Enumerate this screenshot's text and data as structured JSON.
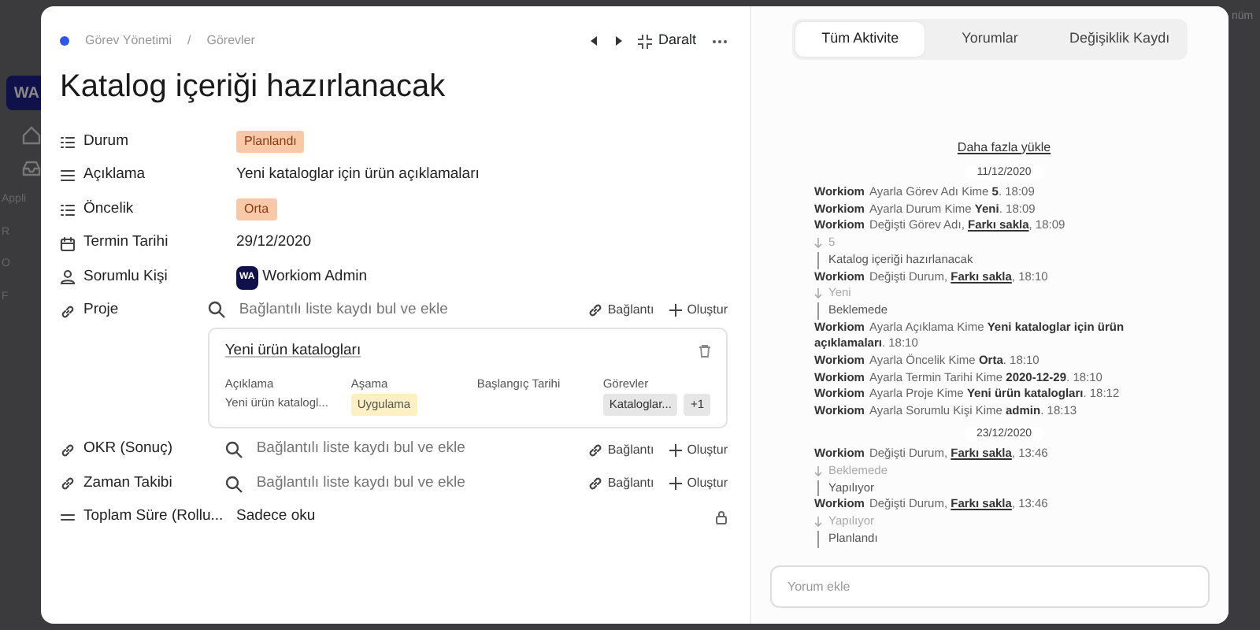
{
  "backdrop": {
    "logo": "WA",
    "section": "Appli",
    "menu_letters": [
      "R",
      "O",
      "F"
    ],
    "right_text": "nüm"
  },
  "breadcrumb": [
    "Görev Yönetimi",
    "Görevler"
  ],
  "breadcrumb_separator": "/",
  "toolbar": {
    "collapse": "Daralt"
  },
  "title": "Katalog içeriği hazırlanacak",
  "fields": [
    {
      "label": "Durum",
      "kind": "badge",
      "value": "Planlandı",
      "color": "#f8c9a8"
    },
    {
      "label": "Açıklama",
      "kind": "text",
      "value": "Yeni kataloglar için ürün açıklamaları"
    },
    {
      "label": "Öncelik",
      "kind": "badge",
      "value": "Orta",
      "color": "#f8c9a8"
    },
    {
      "label": "Termin Tarihi",
      "kind": "text",
      "value": "29/12/2020"
    },
    {
      "label": "Sorumlu Kişi",
      "kind": "user",
      "avatar": "WA",
      "value": "Workiom Admin"
    },
    {
      "label": "Proje",
      "kind": "linked",
      "placeholder": "Bağlantılı liste kaydı bul ve ekle",
      "link_action": "Bağlantı",
      "create_action": "Oluştur",
      "record": {
        "title": "Yeni ürün katalogları",
        "columns": [
          "Açıklama",
          "Aşama",
          "Başlangıç Tarihi",
          "Görevler"
        ],
        "description": "Yeni ürün katalogl...",
        "stage": "Uygulama",
        "tasks": [
          "Kataloglar...",
          "+1"
        ]
      }
    },
    {
      "label": "OKR (Sonuç)",
      "kind": "linked",
      "placeholder": "Bağlantılı liste kaydı bul ve ekle",
      "link_action": "Bağlantı",
      "create_action": "Oluştur"
    },
    {
      "label": "Zaman Takibi",
      "kind": "linked",
      "placeholder": "Bağlantılı liste kaydı bul ve ekle",
      "link_action": "Bağlantı",
      "create_action": "Oluştur"
    },
    {
      "label": "Toplam Süre (Rollu...",
      "kind": "readonly",
      "value": "Sadece oku"
    }
  ],
  "tabs": [
    {
      "label": "Tüm Aktivite",
      "selected": true
    },
    {
      "label": "Yorumlar",
      "selected": false
    },
    {
      "label": "Değişiklik Kaydı",
      "selected": false
    }
  ],
  "load_more": "Daha fazla yükle",
  "activity": [
    {
      "kind": "date",
      "text": "11/12/2020"
    },
    {
      "kind": "set",
      "user": "Workiom",
      "text": "Ayarla Görev Adı Kime  **5**.  18:09"
    },
    {
      "kind": "set",
      "user": "Workiom",
      "text": "Ayarla Durum Kime  **Yeni**.  18:09"
    },
    {
      "kind": "change",
      "user": "Workiom",
      "text": "Değişti Görev Adı,",
      "link": "Farkı sakla",
      "after": ",  18:09",
      "old": "5",
      "new": "Katalog içeriği hazırlanacak"
    },
    {
      "kind": "change",
      "user": "Workiom",
      "text": "Değişti Durum,",
      "link": "Farkı sakla",
      "after": ",  18:10",
      "old": "Yeni",
      "new": "Beklemede"
    },
    {
      "kind": "set",
      "user": "Workiom",
      "text": "Ayarla Açıklama Kime  **Yeni kataloglar için ürün açıklamaları**.  18:10"
    },
    {
      "kind": "set",
      "user": "Workiom",
      "text": "Ayarla Öncelik Kime  **Orta**.  18:10"
    },
    {
      "kind": "set",
      "user": "Workiom",
      "text": "Ayarla Termin Tarihi Kime  **2020-12-29**.  18:10"
    },
    {
      "kind": "set",
      "user": "Workiom",
      "text": "Ayarla Proje Kime  **Yeni ürün katalogları**.  18:12"
    },
    {
      "kind": "set",
      "user": "Workiom",
      "text": "Ayarla Sorumlu Kişi Kime  **admin**.  18:13"
    },
    {
      "kind": "date",
      "text": "23/12/2020"
    },
    {
      "kind": "change",
      "user": "Workiom",
      "text": "Değişti Durum,",
      "link": "Farkı sakla",
      "after": ",  13:46",
      "old": "Beklemede",
      "new": "Yapılıyor"
    },
    {
      "kind": "change",
      "user": "Workiom",
      "text": "Değişti Durum,",
      "link": "Farkı sakla",
      "after": ",  13:46",
      "old": "Yapılıyor",
      "new": "Planlandı"
    }
  ],
  "comment": {
    "placeholder": "Yorum ekle"
  }
}
